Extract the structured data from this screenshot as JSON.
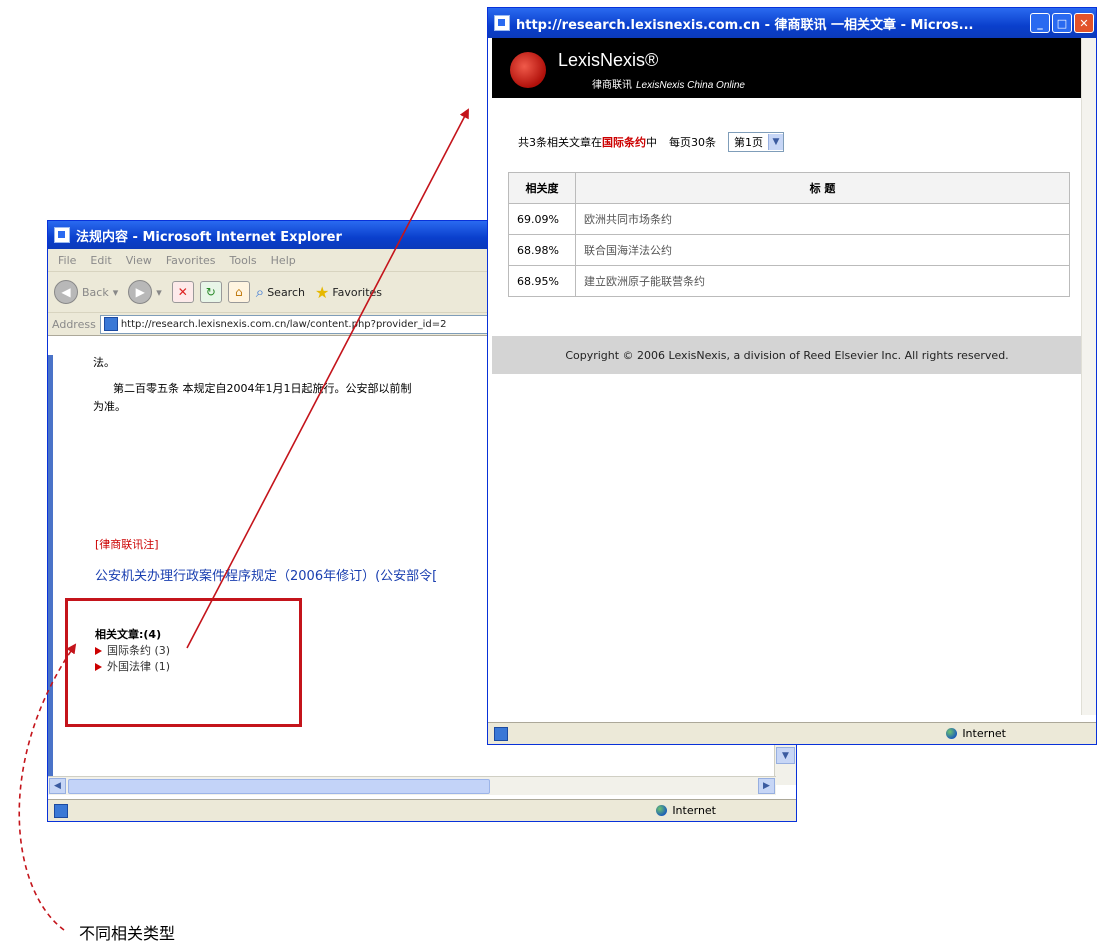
{
  "back_window": {
    "title": "法规内容 - Microsoft Internet Explorer",
    "menu": [
      "File",
      "Edit",
      "View",
      "Favorites",
      "Tools",
      "Help"
    ],
    "toolbar": {
      "back": "Back",
      "search": "Search",
      "favorites": "Favorites"
    },
    "address_label": "Address",
    "address_url": "http://research.lexisnexis.com.cn/law/content.php?provider_id=2",
    "content": {
      "line1": "法。",
      "line2": "第二百零五条  本规定自2004年1月1日起施行。公安部以前制",
      "line3": "为准。",
      "source_note": "[律商联讯注]",
      "law_link": "公安机关办理行政案件程序规定（2006年修订）(公安部令[",
      "related_heading": "相关文章:(4)",
      "related_items": [
        "国际条约 (3)",
        "外国法律 (1)"
      ]
    },
    "status_zone": "Internet"
  },
  "front_window": {
    "title": "http://research.lexisnexis.com.cn - 律商联讯 一相关文章 - Micros...",
    "brand_name": "LexisNexis®",
    "brand_sub_cn": "律商联讯",
    "brand_sub_en": "LexisNexis China Online",
    "summary_prefix": "共3条相关文章在",
    "summary_category": "国际条约",
    "summary_suffix": "中",
    "per_page": "每页30条",
    "page_select": "第1页",
    "table": {
      "headers": [
        "相关度",
        "标 题"
      ],
      "rows": [
        [
          "69.09%",
          "欧洲共同市场条约"
        ],
        [
          "68.98%",
          "联合国海洋法公约"
        ],
        [
          "68.95%",
          "建立欧洲原子能联营条约"
        ]
      ]
    },
    "copyright": "Copyright © 2006 LexisNexis, a division of Reed Elsevier Inc. All rights reserved.",
    "status_zone": "Internet"
  },
  "annotation": {
    "caption": "不同相关类型"
  },
  "colors": {
    "title_blue": "#0a3fcc",
    "highlight_red": "#c4141b",
    "link_blue": "#1a3fb0"
  }
}
